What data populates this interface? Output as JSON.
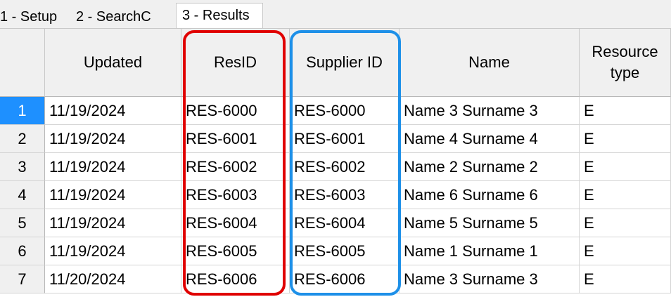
{
  "tabs": [
    {
      "label": "1 - Setup"
    },
    {
      "label": "2 - SearchC"
    },
    {
      "label": "3 - Results"
    }
  ],
  "columns": [
    "",
    "Updated",
    "ResID",
    "Supplier ID",
    "Name",
    "Resource type"
  ],
  "rows": [
    {
      "num": "1",
      "updated": "11/19/2024",
      "resid": "RES-6000",
      "supplier": "RES-6000",
      "name": "Name 3 Surname 3",
      "type": "E"
    },
    {
      "num": "2",
      "updated": "11/19/2024",
      "resid": "RES-6001",
      "supplier": "RES-6001",
      "name": "Name 4 Surname 4",
      "type": "E"
    },
    {
      "num": "3",
      "updated": "11/19/2024",
      "resid": "RES-6002",
      "supplier": "RES-6002",
      "name": "Name 2 Surname 2",
      "type": "E"
    },
    {
      "num": "4",
      "updated": "11/19/2024",
      "resid": "RES-6003",
      "supplier": "RES-6003",
      "name": "Name 6 Surname 6",
      "type": "E"
    },
    {
      "num": "5",
      "updated": "11/19/2024",
      "resid": "RES-6004",
      "supplier": "RES-6004",
      "name": "Name 5 Surname 5",
      "type": "E"
    },
    {
      "num": "6",
      "updated": "11/19/2024",
      "resid": "RES-6005",
      "supplier": "RES-6005",
      "name": "Name 1 Surname 1",
      "type": "E"
    },
    {
      "num": "7",
      "updated": "11/20/2024",
      "resid": "RES-6006",
      "supplier": "RES-6006",
      "name": "Name 3 Surname 3",
      "type": "E"
    }
  ],
  "colors": {
    "highlight_red": "#e00000",
    "highlight_blue": "#1e90e8",
    "selected_row_header": "#1e90ff"
  }
}
